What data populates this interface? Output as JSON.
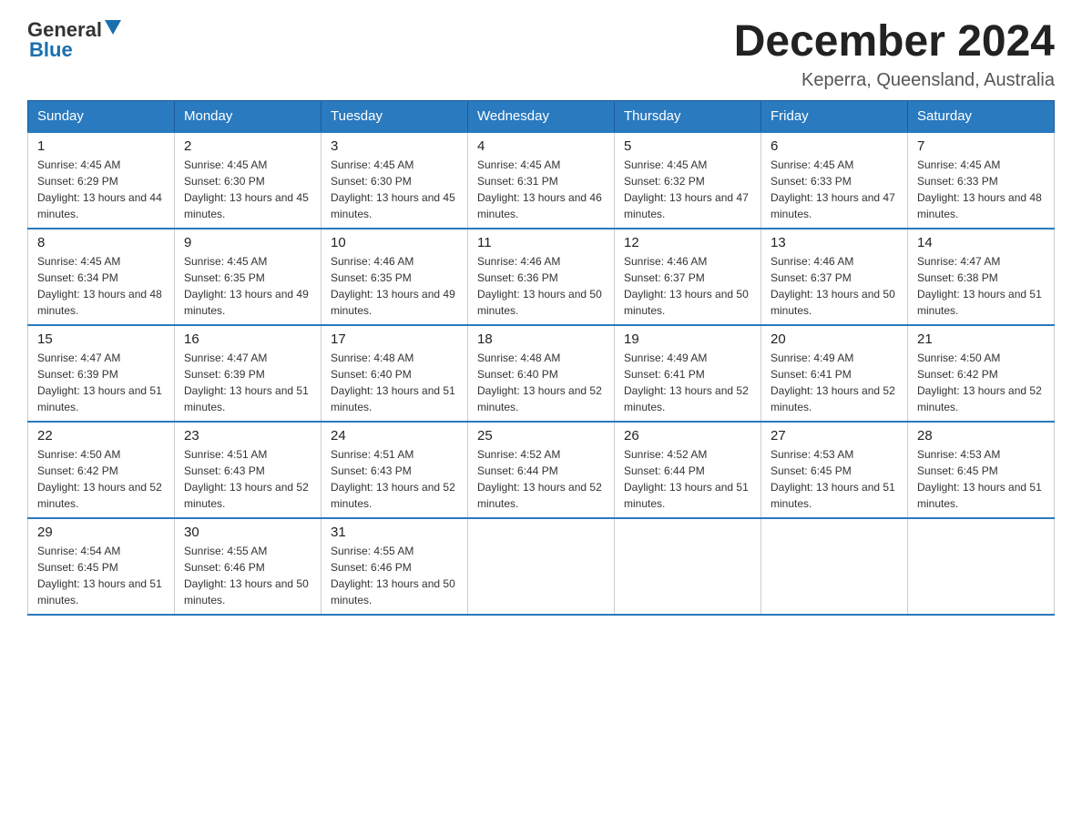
{
  "logo": {
    "general": "General",
    "blue": "Blue"
  },
  "header": {
    "title": "December 2024",
    "location": "Keperra, Queensland, Australia"
  },
  "weekdays": [
    "Sunday",
    "Monday",
    "Tuesday",
    "Wednesday",
    "Thursday",
    "Friday",
    "Saturday"
  ],
  "weeks": [
    [
      {
        "day": "1",
        "sunrise": "4:45 AM",
        "sunset": "6:29 PM",
        "daylight": "13 hours and 44 minutes."
      },
      {
        "day": "2",
        "sunrise": "4:45 AM",
        "sunset": "6:30 PM",
        "daylight": "13 hours and 45 minutes."
      },
      {
        "day": "3",
        "sunrise": "4:45 AM",
        "sunset": "6:30 PM",
        "daylight": "13 hours and 45 minutes."
      },
      {
        "day": "4",
        "sunrise": "4:45 AM",
        "sunset": "6:31 PM",
        "daylight": "13 hours and 46 minutes."
      },
      {
        "day": "5",
        "sunrise": "4:45 AM",
        "sunset": "6:32 PM",
        "daylight": "13 hours and 47 minutes."
      },
      {
        "day": "6",
        "sunrise": "4:45 AM",
        "sunset": "6:33 PM",
        "daylight": "13 hours and 47 minutes."
      },
      {
        "day": "7",
        "sunrise": "4:45 AM",
        "sunset": "6:33 PM",
        "daylight": "13 hours and 48 minutes."
      }
    ],
    [
      {
        "day": "8",
        "sunrise": "4:45 AM",
        "sunset": "6:34 PM",
        "daylight": "13 hours and 48 minutes."
      },
      {
        "day": "9",
        "sunrise": "4:45 AM",
        "sunset": "6:35 PM",
        "daylight": "13 hours and 49 minutes."
      },
      {
        "day": "10",
        "sunrise": "4:46 AM",
        "sunset": "6:35 PM",
        "daylight": "13 hours and 49 minutes."
      },
      {
        "day": "11",
        "sunrise": "4:46 AM",
        "sunset": "6:36 PM",
        "daylight": "13 hours and 50 minutes."
      },
      {
        "day": "12",
        "sunrise": "4:46 AM",
        "sunset": "6:37 PM",
        "daylight": "13 hours and 50 minutes."
      },
      {
        "day": "13",
        "sunrise": "4:46 AM",
        "sunset": "6:37 PM",
        "daylight": "13 hours and 50 minutes."
      },
      {
        "day": "14",
        "sunrise": "4:47 AM",
        "sunset": "6:38 PM",
        "daylight": "13 hours and 51 minutes."
      }
    ],
    [
      {
        "day": "15",
        "sunrise": "4:47 AM",
        "sunset": "6:39 PM",
        "daylight": "13 hours and 51 minutes."
      },
      {
        "day": "16",
        "sunrise": "4:47 AM",
        "sunset": "6:39 PM",
        "daylight": "13 hours and 51 minutes."
      },
      {
        "day": "17",
        "sunrise": "4:48 AM",
        "sunset": "6:40 PM",
        "daylight": "13 hours and 51 minutes."
      },
      {
        "day": "18",
        "sunrise": "4:48 AM",
        "sunset": "6:40 PM",
        "daylight": "13 hours and 52 minutes."
      },
      {
        "day": "19",
        "sunrise": "4:49 AM",
        "sunset": "6:41 PM",
        "daylight": "13 hours and 52 minutes."
      },
      {
        "day": "20",
        "sunrise": "4:49 AM",
        "sunset": "6:41 PM",
        "daylight": "13 hours and 52 minutes."
      },
      {
        "day": "21",
        "sunrise": "4:50 AM",
        "sunset": "6:42 PM",
        "daylight": "13 hours and 52 minutes."
      }
    ],
    [
      {
        "day": "22",
        "sunrise": "4:50 AM",
        "sunset": "6:42 PM",
        "daylight": "13 hours and 52 minutes."
      },
      {
        "day": "23",
        "sunrise": "4:51 AM",
        "sunset": "6:43 PM",
        "daylight": "13 hours and 52 minutes."
      },
      {
        "day": "24",
        "sunrise": "4:51 AM",
        "sunset": "6:43 PM",
        "daylight": "13 hours and 52 minutes."
      },
      {
        "day": "25",
        "sunrise": "4:52 AM",
        "sunset": "6:44 PM",
        "daylight": "13 hours and 52 minutes."
      },
      {
        "day": "26",
        "sunrise": "4:52 AM",
        "sunset": "6:44 PM",
        "daylight": "13 hours and 51 minutes."
      },
      {
        "day": "27",
        "sunrise": "4:53 AM",
        "sunset": "6:45 PM",
        "daylight": "13 hours and 51 minutes."
      },
      {
        "day": "28",
        "sunrise": "4:53 AM",
        "sunset": "6:45 PM",
        "daylight": "13 hours and 51 minutes."
      }
    ],
    [
      {
        "day": "29",
        "sunrise": "4:54 AM",
        "sunset": "6:45 PM",
        "daylight": "13 hours and 51 minutes."
      },
      {
        "day": "30",
        "sunrise": "4:55 AM",
        "sunset": "6:46 PM",
        "daylight": "13 hours and 50 minutes."
      },
      {
        "day": "31",
        "sunrise": "4:55 AM",
        "sunset": "6:46 PM",
        "daylight": "13 hours and 50 minutes."
      },
      null,
      null,
      null,
      null
    ]
  ]
}
